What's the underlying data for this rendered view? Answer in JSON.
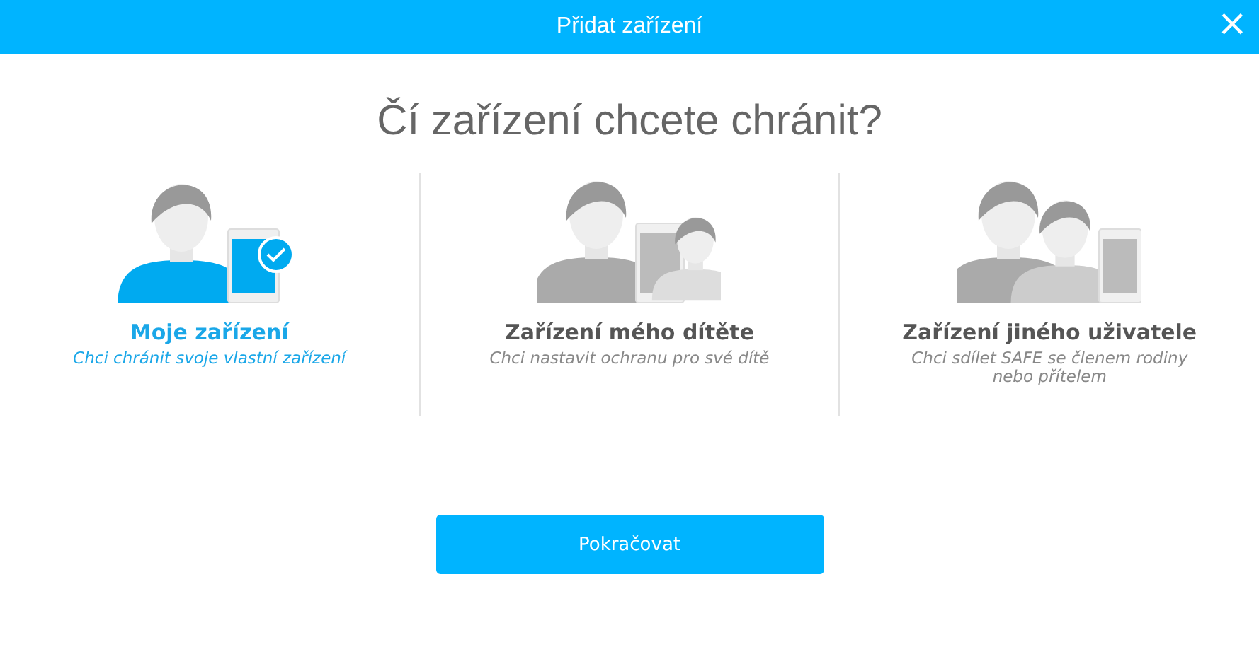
{
  "window": {
    "title": "Přidat zařízení",
    "close": "×"
  },
  "heading": "Čí zařízení chcete chránit?",
  "options": [
    {
      "kind": "self",
      "title": "Moje zařízení",
      "subtitle": "Chci chránit svoje vlastní zařízení",
      "selected": true
    },
    {
      "kind": "child",
      "title": "Zařízení mého dítěte",
      "subtitle": "Chci nastavit ochranu pro své dítě",
      "selected": false
    },
    {
      "kind": "other",
      "title": "Zařízení jiného uživatele",
      "subtitle": "Chci sdílet SAFE se členem rodiny nebo přítelem",
      "selected": false
    }
  ],
  "button": "Pokračovat"
}
